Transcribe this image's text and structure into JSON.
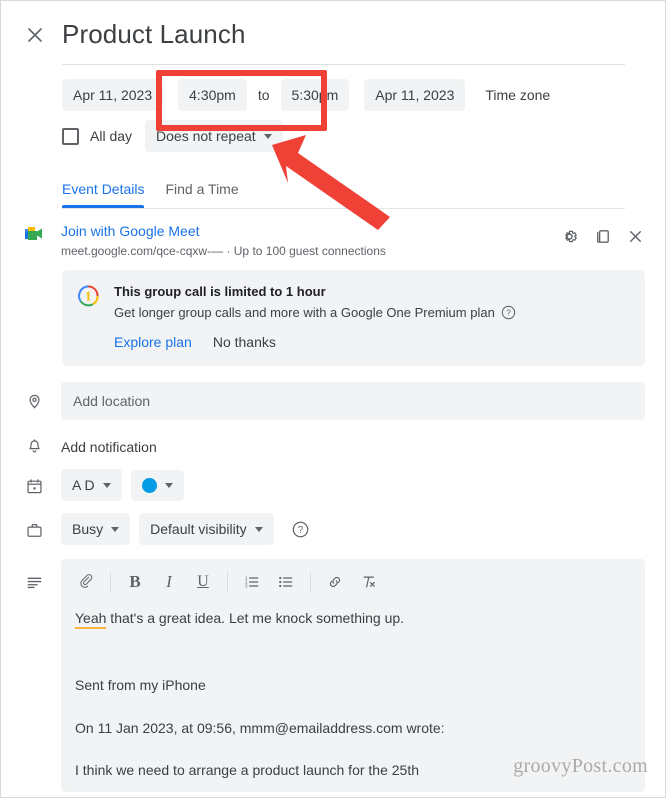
{
  "window": {
    "close_icon": "close-icon",
    "title": "Product Launch"
  },
  "schedule": {
    "start_date": "Apr 11, 2023",
    "start_time": "4:30pm",
    "to_label": "to",
    "end_time": "5:30pm",
    "end_date": "Apr 11, 2023",
    "timezone_label": "Time zone",
    "all_day_label": "All day",
    "recurrence": "Does not repeat"
  },
  "tabs": [
    {
      "label": "Event Details",
      "active": true
    },
    {
      "label": "Find a Time",
      "active": false
    }
  ],
  "meet": {
    "icon": "google-meet-icon",
    "join_link": "Join with Google Meet",
    "url": "meet.google.com/qce-cqxw-—",
    "separator": "·",
    "capacity": "Up to 100 guest connections",
    "actions": [
      {
        "name": "meet-settings-button",
        "icon": "gear-icon"
      },
      {
        "name": "copy-meet-link-button",
        "icon": "copy-icon"
      },
      {
        "name": "remove-meet-button",
        "icon": "close-icon"
      }
    ]
  },
  "promo": {
    "icon": "google-one-icon",
    "title": "This group call is limited to 1 hour",
    "description": "Get longer group calls and more with a Google One Premium plan",
    "help_icon": "help-icon",
    "explore_label": "Explore plan",
    "dismiss_label": "No thanks"
  },
  "fields": {
    "location": {
      "icon": "location-pin-icon",
      "placeholder": "Add location",
      "value": ""
    },
    "notification": {
      "icon": "bell-icon",
      "label": "Add notification"
    },
    "calendar": {
      "icon": "calendar-icon",
      "owner": "A D",
      "color_hex": "#039be5"
    },
    "availability": {
      "icon": "briefcase-icon",
      "busy": "Busy",
      "visibility": "Default visibility",
      "help_icon": "help-icon"
    }
  },
  "editor": {
    "icon": "description-icon",
    "toolbar": [
      {
        "name": "attach-file-button",
        "glyph": "attachment-icon"
      },
      {
        "name": "bold-button",
        "glyph": "B"
      },
      {
        "name": "italic-button",
        "glyph": "I"
      },
      {
        "name": "underline-button",
        "glyph": "U"
      },
      {
        "name": "numbered-list-button",
        "glyph": "numbered-list-icon"
      },
      {
        "name": "bulleted-list-button",
        "glyph": "bulleted-list-icon"
      },
      {
        "name": "insert-link-button",
        "glyph": "link-icon"
      },
      {
        "name": "remove-formatting-button",
        "glyph": "remove-format-icon"
      }
    ],
    "body": {
      "misspelled_word": "Yeah",
      "line1_rest": " that's a great idea. Let me knock something up.",
      "line2": "Sent from my iPhone",
      "line3": "On 11 Jan 2023, at 09:56, mmm@emailaddress.com wrote:",
      "line4": "I think we need to arrange a product launch for the 25th"
    }
  },
  "annotations": {
    "highlight_color": "#ef4136",
    "rectangle_target": "time-range-chips",
    "arrow_target": "time-range-chips"
  },
  "watermark": {
    "text": "groovyPost.com"
  },
  "colors": {
    "accent_blue": "#1a73e8",
    "chip_bg": "#f1f3f4",
    "text_primary": "#3c4043",
    "text_secondary": "#5f6368",
    "annotation_red": "#ef4136",
    "event_color": "#039be5",
    "spellcheck_underline": "#f5b33f"
  }
}
